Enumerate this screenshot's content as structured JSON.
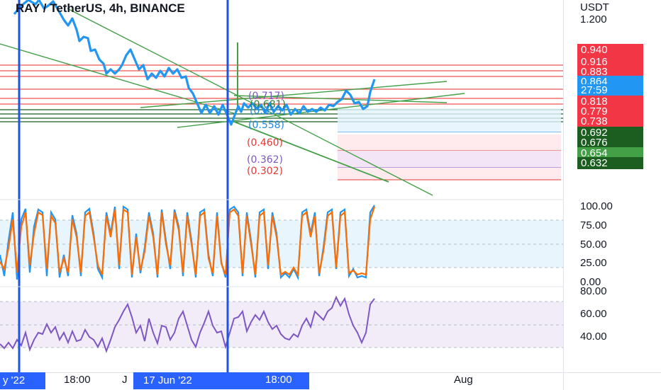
{
  "title": "RAY / TetherUS, 4h, BINANCE",
  "axis": {
    "currency": "USDT",
    "top_tick": "1.200"
  },
  "price_tags": [
    {
      "label": "0.940",
      "color": "#f23645"
    },
    {
      "label": "0.916",
      "color": "#f23645"
    },
    {
      "label": "0.883",
      "color": "#f23645"
    },
    {
      "label": "0.864",
      "color": "#2196f3"
    },
    {
      "label": "27:59",
      "color": "#2196f3"
    },
    {
      "label": "0.818",
      "color": "#f23645"
    },
    {
      "label": "0.779",
      "color": "#f23645"
    },
    {
      "label": "0.738",
      "color": "#f23645"
    },
    {
      "label": "0.692",
      "color": "#1b5e20"
    },
    {
      "label": "0.676",
      "color": "#1b5e20"
    },
    {
      "label": "0.654",
      "color": "#43a047"
    },
    {
      "label": "0.632",
      "color": "#1b5e20"
    }
  ],
  "fib_labels": [
    {
      "label": "(0.717)",
      "color": "#7e57c2"
    },
    {
      "label": "(0.681)",
      "color": "#2e7d32"
    },
    {
      "label": "(0.653)",
      "color": "#1e88e5"
    },
    {
      "label": "(0.558)",
      "color": "#1e88e5"
    },
    {
      "label": "(0.460)",
      "color": "#e53935"
    },
    {
      "label": "(0.362)",
      "color": "#7e57c2"
    },
    {
      "label": "(0.302)",
      "color": "#e53935"
    }
  ],
  "osc1_ticks": [
    "100.00",
    "75.00",
    "50.00",
    "25.00",
    "0.00"
  ],
  "osc2_ticks": [
    "80.00",
    "60.00",
    "40.00"
  ],
  "time_labels": {
    "left_box": "y '22",
    "t1": "18:00",
    "j": "J",
    "mid_box": "17 Jun '22",
    "t2": "18:00",
    "aug": "Aug"
  },
  "colors": {
    "price_line": "#2196f3",
    "trend_green": "#43a047",
    "marker_blue": "#1e53e5",
    "stoch_k": "#2196f3",
    "stoch_d": "#ff6d00",
    "rsi": "#7e57c2"
  }
}
